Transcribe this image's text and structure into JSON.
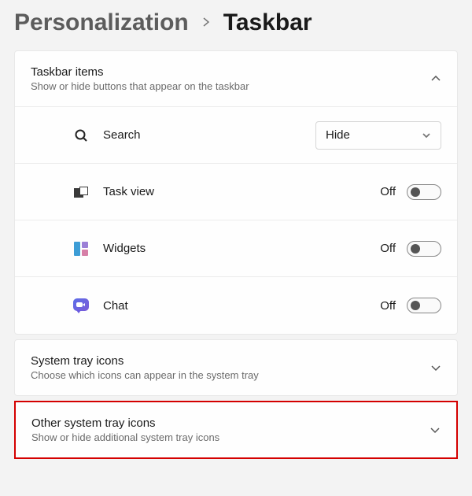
{
  "breadcrumb": {
    "parent": "Personalization",
    "current": "Taskbar"
  },
  "sections": {
    "taskbar_items": {
      "title": "Taskbar items",
      "subtitle": "Show or hide buttons that appear on the taskbar",
      "expanded": true,
      "items": {
        "search": {
          "label": "Search",
          "control": "dropdown",
          "value": "Hide"
        },
        "task_view": {
          "label": "Task view",
          "control": "toggle",
          "state_label": "Off",
          "on": false
        },
        "widgets": {
          "label": "Widgets",
          "control": "toggle",
          "state_label": "Off",
          "on": false
        },
        "chat": {
          "label": "Chat",
          "control": "toggle",
          "state_label": "Off",
          "on": false
        }
      }
    },
    "system_tray": {
      "title": "System tray icons",
      "subtitle": "Choose which icons can appear in the system tray",
      "expanded": false
    },
    "other_system_tray": {
      "title": "Other system tray icons",
      "subtitle": "Show or hide additional system tray icons",
      "expanded": false,
      "highlighted": true
    }
  }
}
